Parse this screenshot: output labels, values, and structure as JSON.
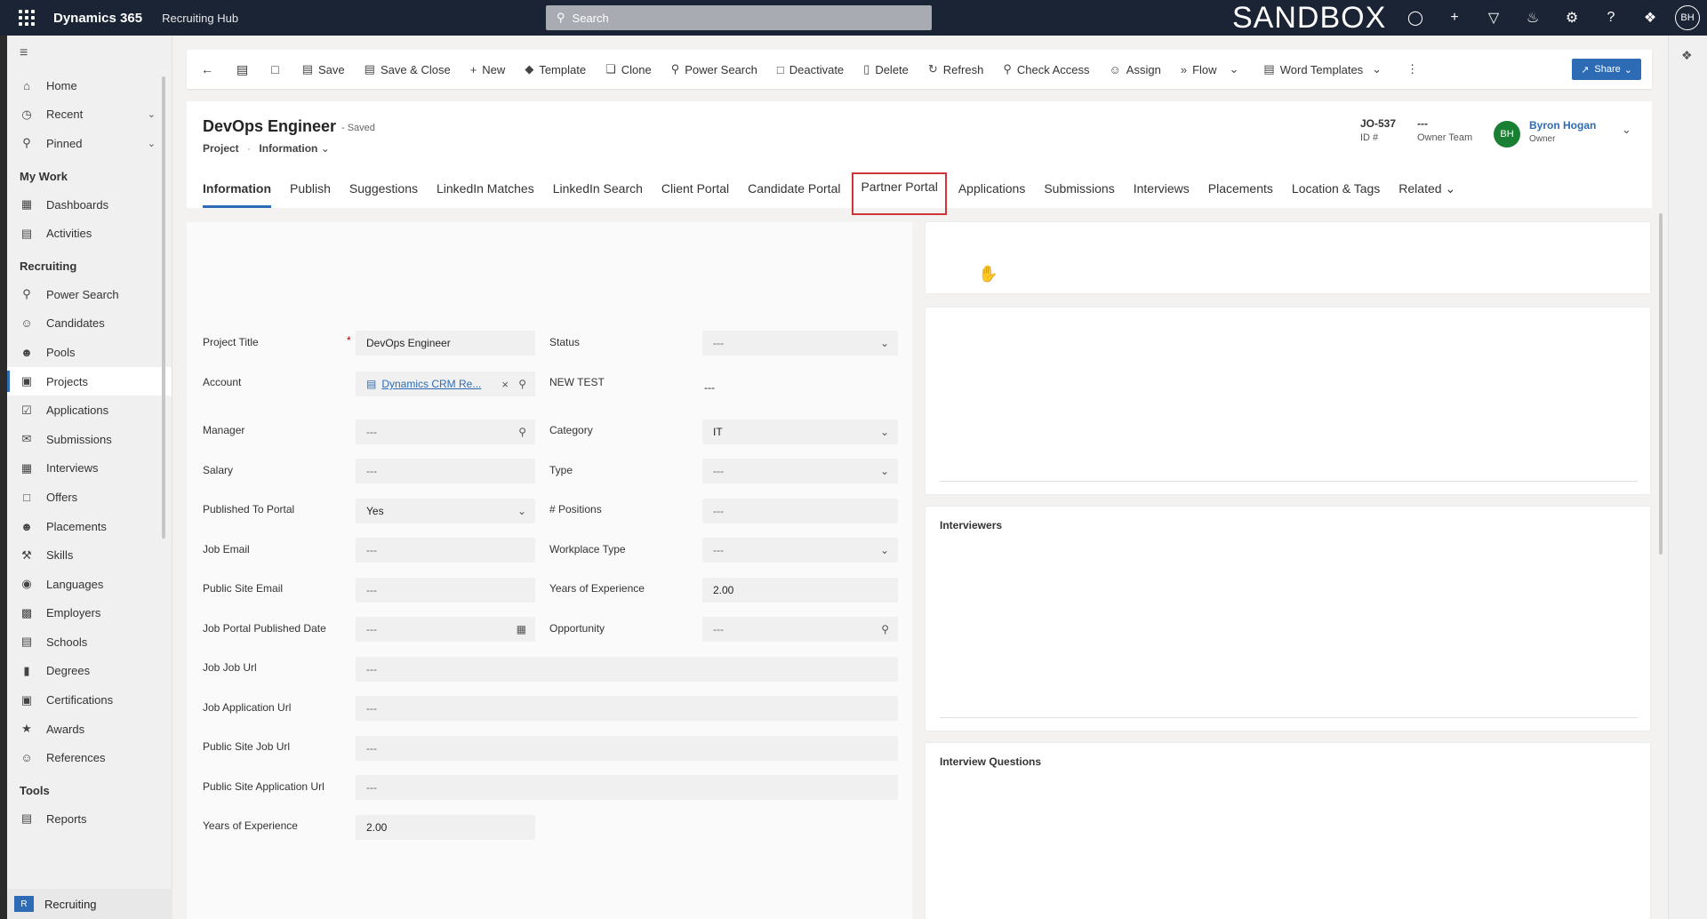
{
  "topbar": {
    "brand": "Dynamics 365",
    "app": "Recruiting Hub",
    "search_placeholder": "Search",
    "environment": "SANDBOX",
    "user_initials": "BH"
  },
  "sidebar": {
    "top_items": [
      {
        "label": "Home",
        "icon": "home-icon"
      },
      {
        "label": "Recent",
        "icon": "clock-icon"
      },
      {
        "label": "Pinned",
        "icon": "pin-icon"
      }
    ],
    "groups": [
      {
        "title": "My Work",
        "items": [
          {
            "label": "Dashboards"
          },
          {
            "label": "Activities"
          }
        ]
      },
      {
        "title": "Recruiting",
        "items": [
          {
            "label": "Power Search"
          },
          {
            "label": "Candidates"
          },
          {
            "label": "Pools"
          },
          {
            "label": "Projects"
          },
          {
            "label": "Applications"
          },
          {
            "label": "Submissions"
          },
          {
            "label": "Interviews"
          },
          {
            "label": "Offers"
          },
          {
            "label": "Placements"
          },
          {
            "label": "Skills"
          },
          {
            "label": "Languages"
          },
          {
            "label": "Employers"
          },
          {
            "label": "Schools"
          },
          {
            "label": "Degrees"
          },
          {
            "label": "Certifications"
          },
          {
            "label": "Awards"
          },
          {
            "label": "References"
          }
        ]
      },
      {
        "title": "Tools",
        "items": [
          {
            "label": "Reports"
          }
        ]
      }
    ],
    "bottom": {
      "badge": "R",
      "label": "Recruiting"
    }
  },
  "commandbar": {
    "save": "Save",
    "save_close": "Save & Close",
    "new": "New",
    "template": "Template",
    "clone": "Clone",
    "power_search": "Power Search",
    "deactivate": "Deactivate",
    "delete": "Delete",
    "refresh": "Refresh",
    "check_access": "Check Access",
    "assign": "Assign",
    "flow": "Flow",
    "word_templates": "Word Templates",
    "share": "Share"
  },
  "record": {
    "title": "DevOps Engineer",
    "saved": "- Saved",
    "entity": "Project",
    "form": "Information",
    "id_value": "JO-537",
    "id_label": "ID #",
    "owner_team_value": "---",
    "owner_team_label": "Owner Team",
    "owner_initials": "BH",
    "owner_name": "Byron Hogan",
    "owner_label": "Owner"
  },
  "tabs": [
    "Information",
    "Publish",
    "Suggestions",
    "LinkedIn Matches",
    "LinkedIn Search",
    "Client Portal",
    "Candidate Portal",
    "Partner Portal",
    "Applications",
    "Submissions",
    "Interviews",
    "Placements",
    "Location & Tags",
    "Related"
  ],
  "form": {
    "project_title_label": "Project Title",
    "project_title_value": "DevOps Engineer",
    "account_label": "Account",
    "account_value": "Dynamics CRM Re...",
    "manager_label": "Manager",
    "manager_value": "---",
    "salary_label": "Salary",
    "salary_value": "---",
    "published_label": "Published To Portal",
    "published_value": "Yes",
    "job_email_label": "Job Email",
    "job_email_value": "---",
    "public_email_label": "Public Site Email",
    "public_email_value": "---",
    "portal_date_label": "Job Portal Published Date",
    "portal_date_value": "---",
    "job_url_label": "Job Job Url",
    "job_url_value": "---",
    "app_url_label": "Job Application Url",
    "app_url_value": "---",
    "public_job_url_label": "Public Site Job Url",
    "public_job_url_value": "---",
    "public_app_url_label": "Public Site Application Url",
    "public_app_url_value": "---",
    "years_exp_label": "Years of Experience",
    "years_exp_value": "2.00",
    "status_label": "Status",
    "status_value": "---",
    "new_test_label": "NEW TEST",
    "new_test_value": "---",
    "category_label": "Category",
    "category_value": "IT",
    "type_label": "Type",
    "type_value": "---",
    "positions_label": "# Positions",
    "positions_value": "---",
    "workplace_label": "Workplace Type",
    "workplace_value": "---",
    "years_exp2_label": "Years of Experience",
    "years_exp2_value": "2.00",
    "opportunity_label": "Opportunity",
    "opportunity_value": "---"
  },
  "right_panels": {
    "interviewers": "Interviewers",
    "interview_questions": "Interview Questions"
  },
  "colors": {
    "accent": "#2d6cb5",
    "topbar": "#1b2435",
    "highlight_box": "#d13438",
    "owner_avatar": "#187f33"
  }
}
